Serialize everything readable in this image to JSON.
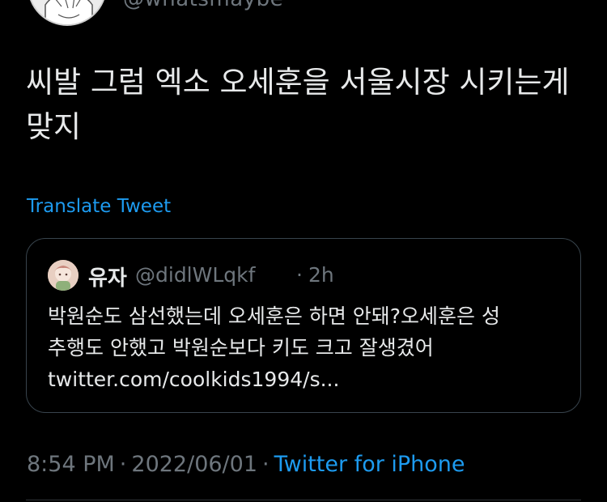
{
  "author": {
    "handle": "@whatsmaybe"
  },
  "tweet": {
    "text": "씨발 그럼 엑소 오세훈을 서울시장 시키는게 맞지",
    "translate_label": "Translate Tweet"
  },
  "quoted_tweet": {
    "name": "유자",
    "handle": "@didlWLqkf",
    "separator": "·",
    "time": "2h",
    "lines": [
      "박원순도 삼선했는데 오세훈은 하면 안돼?오세훈은 성",
      "추행도 안했고 박원순보다 키도 크고 잘생겼어",
      "twitter.com/coolkids1994/s..."
    ]
  },
  "meta": {
    "time": "8:54 PM",
    "date": "2022/06/01",
    "separator": "·",
    "source": "Twitter for iPhone"
  },
  "colors": {
    "background": "#000000",
    "text": "#e7e9ea",
    "secondary": "#6e767d",
    "link": "#1d9bf0",
    "border": "#38444d"
  }
}
